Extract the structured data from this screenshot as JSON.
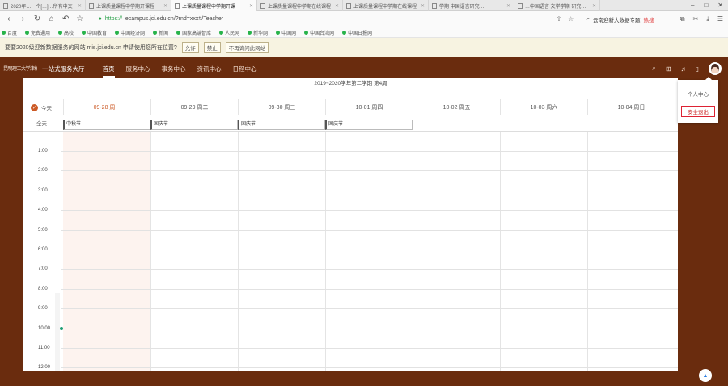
{
  "browser": {
    "tabs": [
      {
        "title": "2020年…一个[…]…所有中文",
        "active": false
      },
      {
        "title": "上课质量课程中学期开课程",
        "active": false
      },
      {
        "title": "上课质量课程中学期开课",
        "active": true
      },
      {
        "title": "上课质量课程中学期在线课程",
        "active": false
      },
      {
        "title": "上课质量课程中学期在线课程 …",
        "active": false
      },
      {
        "title": "学期 中国语言研究…",
        "active": false
      },
      {
        "title": "…中国语言 文学学期 研究…",
        "active": false
      }
    ],
    "url_scheme": "https://",
    "url_rest": "ecampus.jci.edu.cn/?rnd=xxx#/Teacher",
    "search_text": "云南迎新大数据专题",
    "search_hot": "热搜",
    "bookmarks": [
      "百度",
      "免费通用",
      "高校",
      "中国教育",
      "中国经济网",
      "新闻",
      "国家高端智库",
      "人民网",
      "新华网",
      "中国网",
      "中国台湾网",
      "中国日报网"
    ]
  },
  "notice": {
    "text": "要要2020级迎新数据服务的网站 mis.jci.edu.cn 申请使用您所在位置?",
    "allow": "允许",
    "deny": "禁止",
    "dismiss": "不再询问此网站"
  },
  "site": {
    "logo": "昆明理工大学津桥学院",
    "title": "一站式服务大厅",
    "nav": [
      {
        "label": "首页",
        "active": true
      },
      {
        "label": "服务中心",
        "active": false
      },
      {
        "label": "事务中心",
        "active": false
      },
      {
        "label": "资讯中心",
        "active": false
      },
      {
        "label": "日程中心",
        "active": false
      }
    ],
    "user_menu": {
      "profile": "个人中心",
      "logout": "安全退出"
    }
  },
  "calendar": {
    "semester": "2019~2020学年第二学期 第4周",
    "today_label": "今天",
    "allday_label": "全天",
    "days": [
      {
        "label": "09-28 周一",
        "today": true
      },
      {
        "label": "09-29 周二",
        "today": false
      },
      {
        "label": "09-30 周三",
        "today": false
      },
      {
        "label": "10-01 周四",
        "today": false
      },
      {
        "label": "10-02 周五",
        "today": false
      },
      {
        "label": "10-03 周六",
        "today": false
      },
      {
        "label": "10-04 周日",
        "today": false
      }
    ],
    "allday_events": [
      "中秋节",
      "国庆节",
      "国庆节",
      "国庆节"
    ],
    "hours": [
      "1:00",
      "2:00",
      "3:00",
      "4:00",
      "5:00",
      "6:00",
      "7:00",
      "8:00",
      "9:00",
      "10:00",
      "11:00",
      "12:00"
    ]
  }
}
